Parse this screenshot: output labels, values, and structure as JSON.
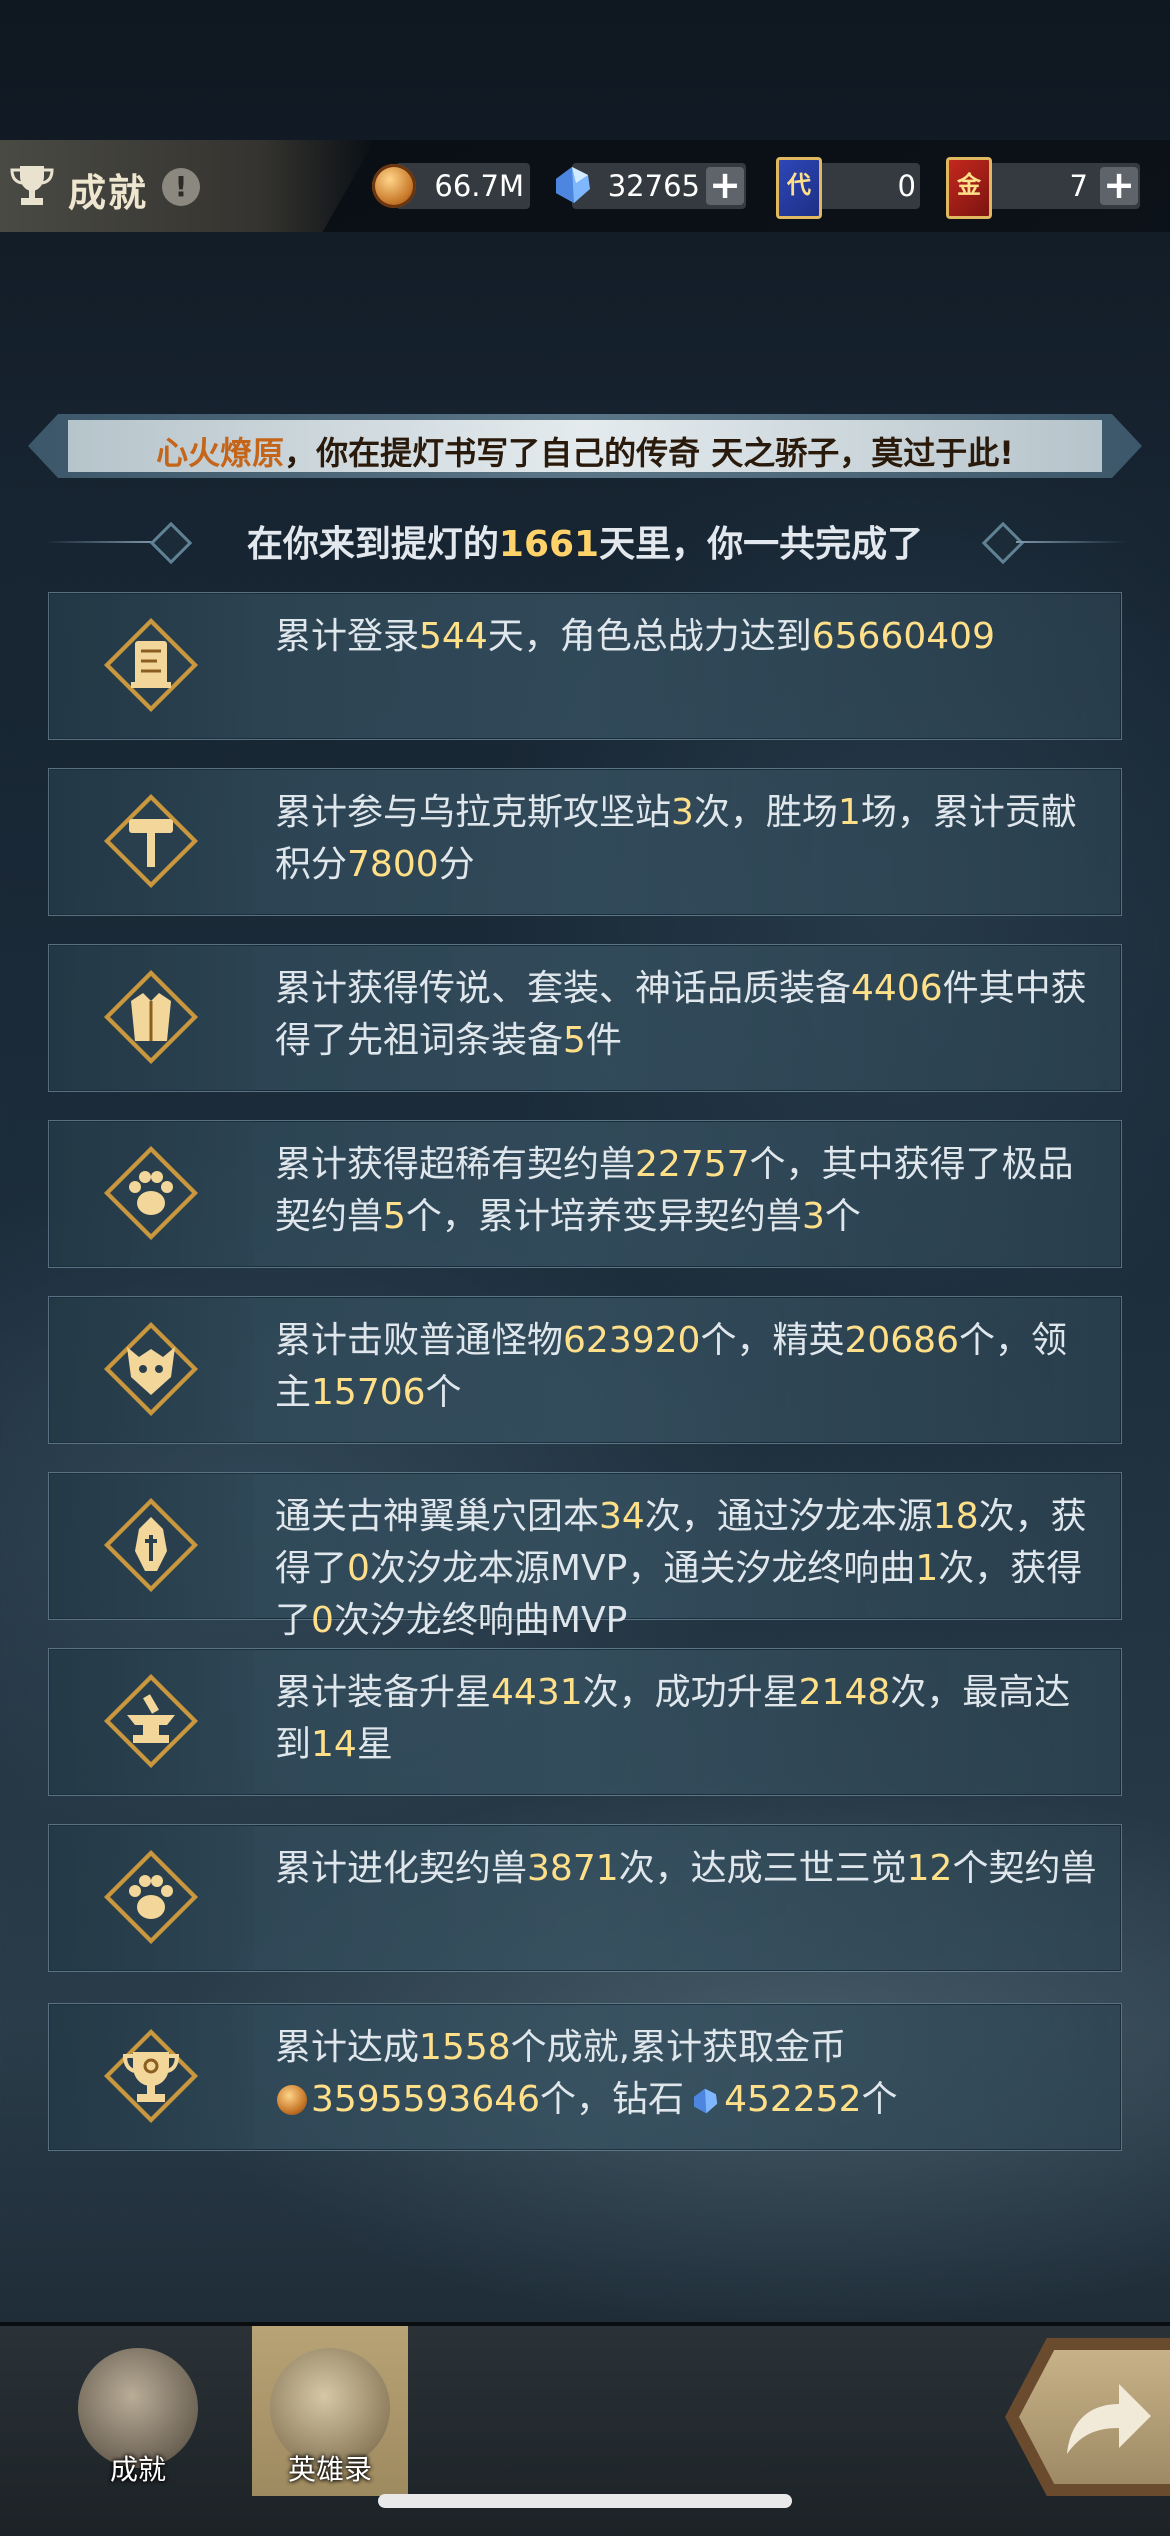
{
  "header": {
    "title": "成就",
    "resources": {
      "gold": "66.7M",
      "diamond": "32765",
      "token_card_label": "代",
      "token_card": "0",
      "gold_card_label": "金",
      "gold_card": "7"
    }
  },
  "banner": {
    "highlight": "心火燎原",
    "text": "，你在提灯书写了自己的传奇 天之骄子，莫过于此!"
  },
  "summary": {
    "prefix": "在你来到提灯的",
    "days": "1661",
    "suffix": "天里，你一共完成了"
  },
  "achievements": [
    {
      "icon": "scroll-icon",
      "parts": [
        [
          "累计登录",
          0
        ],
        [
          "544",
          1
        ],
        [
          "天，角色总战力达到",
          0
        ],
        [
          "65660409",
          1
        ]
      ]
    },
    {
      "icon": "hammer-icon",
      "parts": [
        [
          "累计参与乌拉克斯攻坚站",
          0
        ],
        [
          "3",
          1
        ],
        [
          "次，胜场",
          0
        ],
        [
          "1",
          1
        ],
        [
          "场，累计贡献积分",
          0
        ],
        [
          "7800",
          1
        ],
        [
          "分",
          0
        ]
      ]
    },
    {
      "icon": "armor-icon",
      "parts": [
        [
          "累计获得传说、套装、神话品质装备",
          0
        ],
        [
          "4406",
          1
        ],
        [
          "件其中获得了先祖词条装备",
          0
        ],
        [
          "5",
          1
        ],
        [
          "件",
          0
        ]
      ]
    },
    {
      "icon": "paw-icon",
      "parts": [
        [
          "累计获得超稀有契约兽",
          0
        ],
        [
          "22757",
          1
        ],
        [
          "个，其中获得了极品契约兽",
          0
        ],
        [
          "5",
          1
        ],
        [
          "个，累计培养变异契约兽",
          0
        ],
        [
          "3",
          1
        ],
        [
          "个",
          0
        ]
      ]
    },
    {
      "icon": "demon-mask-icon",
      "parts": [
        [
          "累计击败普通怪物",
          0
        ],
        [
          "623920",
          1
        ],
        [
          "个，精英",
          0
        ],
        [
          "20686",
          1
        ],
        [
          "个，领主",
          0
        ],
        [
          "15706",
          1
        ],
        [
          "个",
          0
        ]
      ]
    },
    {
      "icon": "dragon-helm-icon",
      "parts": [
        [
          "通关古神翼巢穴团本",
          0
        ],
        [
          "34",
          1
        ],
        [
          "次，通过汐龙本源",
          0
        ],
        [
          "18",
          1
        ],
        [
          "次，获得了",
          0
        ],
        [
          "0",
          1
        ],
        [
          "次汐龙本源MVP，通关汐龙终响曲",
          0
        ],
        [
          "1",
          1
        ],
        [
          "次，获得了",
          0
        ],
        [
          "0",
          1
        ],
        [
          "次汐龙终响曲MVP",
          0
        ]
      ]
    },
    {
      "icon": "anvil-icon",
      "parts": [
        [
          "累计装备升星",
          0
        ],
        [
          "4431",
          1
        ],
        [
          "次，成功升星",
          0
        ],
        [
          "2148",
          1
        ],
        [
          "次，最高达到",
          0
        ],
        [
          "14",
          1
        ],
        [
          "星",
          0
        ]
      ]
    },
    {
      "icon": "paw-icon",
      "parts": [
        [
          "累计进化契约兽",
          0
        ],
        [
          "3871",
          1
        ],
        [
          "次，达成三世三觉",
          0
        ],
        [
          "12",
          1
        ],
        [
          "个契约兽",
          0
        ]
      ]
    }
  ],
  "final_achievement": {
    "icon": "trophy-icon",
    "prefix": "累计达成",
    "count": "1558",
    "mid": "个成就,累计获取金币",
    "gold": "3595593646",
    "mid2": "个，钻石",
    "diamond": "452252",
    "suffix": "个"
  },
  "bottom_tabs": [
    {
      "label": "成就",
      "active": false
    },
    {
      "label": "英雄录",
      "active": true
    }
  ],
  "colors": {
    "highlight": "#ffe089",
    "banner_highlight": "#c4651a"
  }
}
